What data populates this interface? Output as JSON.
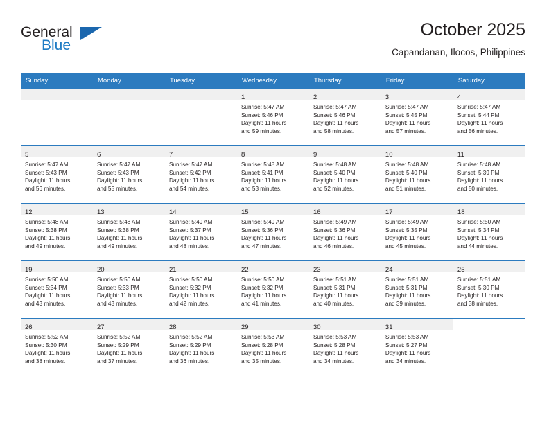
{
  "brand": {
    "name_part1": "General",
    "name_part2": "Blue",
    "triangle_color": "#1b67ae",
    "blue_color": "#1e7bc4"
  },
  "header": {
    "title": "October 2025",
    "subtitle": "Capandanan, Ilocos, Philippines"
  },
  "theme": {
    "header_bg": "#2c7bbf",
    "daynum_bg": "#f0f0f0",
    "text": "#231f20"
  },
  "weekdays": [
    "Sunday",
    "Monday",
    "Tuesday",
    "Wednesday",
    "Thursday",
    "Friday",
    "Saturday"
  ],
  "labels": {
    "sunrise": "Sunrise:",
    "sunset": "Sunset:",
    "daylight": "Daylight:"
  },
  "weeks": [
    [
      {
        "day": "",
        "empty": true
      },
      {
        "day": "",
        "empty": true
      },
      {
        "day": "",
        "empty": true
      },
      {
        "day": "1",
        "sunrise": "Sunrise: 5:47 AM",
        "sunset": "Sunset: 5:46 PM",
        "daylight_line1": "Daylight: 11 hours",
        "daylight_line2": "and 59 minutes."
      },
      {
        "day": "2",
        "sunrise": "Sunrise: 5:47 AM",
        "sunset": "Sunset: 5:46 PM",
        "daylight_line1": "Daylight: 11 hours",
        "daylight_line2": "and 58 minutes."
      },
      {
        "day": "3",
        "sunrise": "Sunrise: 5:47 AM",
        "sunset": "Sunset: 5:45 PM",
        "daylight_line1": "Daylight: 11 hours",
        "daylight_line2": "and 57 minutes."
      },
      {
        "day": "4",
        "sunrise": "Sunrise: 5:47 AM",
        "sunset": "Sunset: 5:44 PM",
        "daylight_line1": "Daylight: 11 hours",
        "daylight_line2": "and 56 minutes."
      }
    ],
    [
      {
        "day": "5",
        "sunrise": "Sunrise: 5:47 AM",
        "sunset": "Sunset: 5:43 PM",
        "daylight_line1": "Daylight: 11 hours",
        "daylight_line2": "and 56 minutes."
      },
      {
        "day": "6",
        "sunrise": "Sunrise: 5:47 AM",
        "sunset": "Sunset: 5:43 PM",
        "daylight_line1": "Daylight: 11 hours",
        "daylight_line2": "and 55 minutes."
      },
      {
        "day": "7",
        "sunrise": "Sunrise: 5:47 AM",
        "sunset": "Sunset: 5:42 PM",
        "daylight_line1": "Daylight: 11 hours",
        "daylight_line2": "and 54 minutes."
      },
      {
        "day": "8",
        "sunrise": "Sunrise: 5:48 AM",
        "sunset": "Sunset: 5:41 PM",
        "daylight_line1": "Daylight: 11 hours",
        "daylight_line2": "and 53 minutes."
      },
      {
        "day": "9",
        "sunrise": "Sunrise: 5:48 AM",
        "sunset": "Sunset: 5:40 PM",
        "daylight_line1": "Daylight: 11 hours",
        "daylight_line2": "and 52 minutes."
      },
      {
        "day": "10",
        "sunrise": "Sunrise: 5:48 AM",
        "sunset": "Sunset: 5:40 PM",
        "daylight_line1": "Daylight: 11 hours",
        "daylight_line2": "and 51 minutes."
      },
      {
        "day": "11",
        "sunrise": "Sunrise: 5:48 AM",
        "sunset": "Sunset: 5:39 PM",
        "daylight_line1": "Daylight: 11 hours",
        "daylight_line2": "and 50 minutes."
      }
    ],
    [
      {
        "day": "12",
        "sunrise": "Sunrise: 5:48 AM",
        "sunset": "Sunset: 5:38 PM",
        "daylight_line1": "Daylight: 11 hours",
        "daylight_line2": "and 49 minutes."
      },
      {
        "day": "13",
        "sunrise": "Sunrise: 5:48 AM",
        "sunset": "Sunset: 5:38 PM",
        "daylight_line1": "Daylight: 11 hours",
        "daylight_line2": "and 49 minutes."
      },
      {
        "day": "14",
        "sunrise": "Sunrise: 5:49 AM",
        "sunset": "Sunset: 5:37 PM",
        "daylight_line1": "Daylight: 11 hours",
        "daylight_line2": "and 48 minutes."
      },
      {
        "day": "15",
        "sunrise": "Sunrise: 5:49 AM",
        "sunset": "Sunset: 5:36 PM",
        "daylight_line1": "Daylight: 11 hours",
        "daylight_line2": "and 47 minutes."
      },
      {
        "day": "16",
        "sunrise": "Sunrise: 5:49 AM",
        "sunset": "Sunset: 5:36 PM",
        "daylight_line1": "Daylight: 11 hours",
        "daylight_line2": "and 46 minutes."
      },
      {
        "day": "17",
        "sunrise": "Sunrise: 5:49 AM",
        "sunset": "Sunset: 5:35 PM",
        "daylight_line1": "Daylight: 11 hours",
        "daylight_line2": "and 45 minutes."
      },
      {
        "day": "18",
        "sunrise": "Sunrise: 5:50 AM",
        "sunset": "Sunset: 5:34 PM",
        "daylight_line1": "Daylight: 11 hours",
        "daylight_line2": "and 44 minutes."
      }
    ],
    [
      {
        "day": "19",
        "sunrise": "Sunrise: 5:50 AM",
        "sunset": "Sunset: 5:34 PM",
        "daylight_line1": "Daylight: 11 hours",
        "daylight_line2": "and 43 minutes."
      },
      {
        "day": "20",
        "sunrise": "Sunrise: 5:50 AM",
        "sunset": "Sunset: 5:33 PM",
        "daylight_line1": "Daylight: 11 hours",
        "daylight_line2": "and 43 minutes."
      },
      {
        "day": "21",
        "sunrise": "Sunrise: 5:50 AM",
        "sunset": "Sunset: 5:32 PM",
        "daylight_line1": "Daylight: 11 hours",
        "daylight_line2": "and 42 minutes."
      },
      {
        "day": "22",
        "sunrise": "Sunrise: 5:50 AM",
        "sunset": "Sunset: 5:32 PM",
        "daylight_line1": "Daylight: 11 hours",
        "daylight_line2": "and 41 minutes."
      },
      {
        "day": "23",
        "sunrise": "Sunrise: 5:51 AM",
        "sunset": "Sunset: 5:31 PM",
        "daylight_line1": "Daylight: 11 hours",
        "daylight_line2": "and 40 minutes."
      },
      {
        "day": "24",
        "sunrise": "Sunrise: 5:51 AM",
        "sunset": "Sunset: 5:31 PM",
        "daylight_line1": "Daylight: 11 hours",
        "daylight_line2": "and 39 minutes."
      },
      {
        "day": "25",
        "sunrise": "Sunrise: 5:51 AM",
        "sunset": "Sunset: 5:30 PM",
        "daylight_line1": "Daylight: 11 hours",
        "daylight_line2": "and 38 minutes."
      }
    ],
    [
      {
        "day": "26",
        "sunrise": "Sunrise: 5:52 AM",
        "sunset": "Sunset: 5:30 PM",
        "daylight_line1": "Daylight: 11 hours",
        "daylight_line2": "and 38 minutes."
      },
      {
        "day": "27",
        "sunrise": "Sunrise: 5:52 AM",
        "sunset": "Sunset: 5:29 PM",
        "daylight_line1": "Daylight: 11 hours",
        "daylight_line2": "and 37 minutes."
      },
      {
        "day": "28",
        "sunrise": "Sunrise: 5:52 AM",
        "sunset": "Sunset: 5:29 PM",
        "daylight_line1": "Daylight: 11 hours",
        "daylight_line2": "and 36 minutes."
      },
      {
        "day": "29",
        "sunrise": "Sunrise: 5:53 AM",
        "sunset": "Sunset: 5:28 PM",
        "daylight_line1": "Daylight: 11 hours",
        "daylight_line2": "and 35 minutes."
      },
      {
        "day": "30",
        "sunrise": "Sunrise: 5:53 AM",
        "sunset": "Sunset: 5:28 PM",
        "daylight_line1": "Daylight: 11 hours",
        "daylight_line2": "and 34 minutes."
      },
      {
        "day": "31",
        "sunrise": "Sunrise: 5:53 AM",
        "sunset": "Sunset: 5:27 PM",
        "daylight_line1": "Daylight: 11 hours",
        "daylight_line2": "and 34 minutes."
      },
      {
        "day": "",
        "empty": true,
        "no_strip": true
      }
    ]
  ]
}
